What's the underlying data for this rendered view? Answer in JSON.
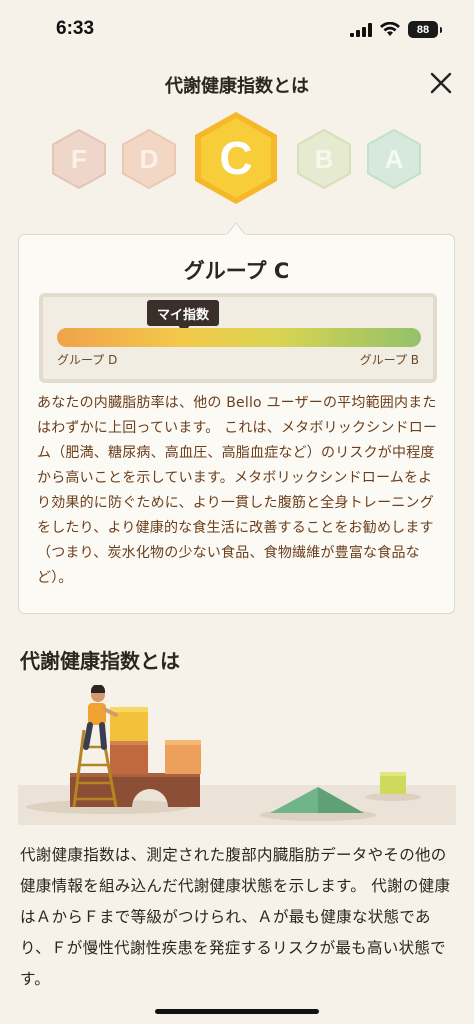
{
  "status_bar": {
    "time": "6:33",
    "battery": "88"
  },
  "header": {
    "title": "代謝健康指数とは"
  },
  "grades": [
    "F",
    "D",
    "C",
    "B",
    "A"
  ],
  "selected_grade": "C",
  "card": {
    "title": "グループ C",
    "meter": {
      "tag": "マイ指数",
      "left_label": "グループ D",
      "right_label": "グループ B"
    },
    "description": "あなたの内臓脂肪率は、他の Bello ユーザーの平均範囲内またはわずかに上回っています。 これは、メタボリックシンドローム（肥満、糖尿病、高血圧、高脂血症など）のリスクが中程度から高いことを示しています。メタボリックシンドロームをより効果的に防ぐために、より一貫した腹筋と全身トレーニングをしたり、より健康的な食生活に改善することをお勧めします（つまり、炭水化物の少ない食品、食物繊維が豊富な食品など）。"
  },
  "section": {
    "title": "代謝健康指数とは",
    "body": "代謝健康指数は、測定された腹部内臓脂肪データやその他の健康情報を組み込んだ代謝健康状態を示します。 代謝の健康はＡからＦまで等級がつけられ、Ａが最も健康な状態であり、Ｆが慢性代謝性疾患を発症するリスクが最も高い状態です。"
  },
  "colors": {
    "background": "#f6f2e9",
    "grade_F": "#e8b9a8",
    "grade_D": "#efc3a4",
    "grade_C": "#f6c42f",
    "grade_B": "#d9e0b0",
    "grade_A": "#b8dcc0",
    "description_text": "#6b3e1c"
  }
}
